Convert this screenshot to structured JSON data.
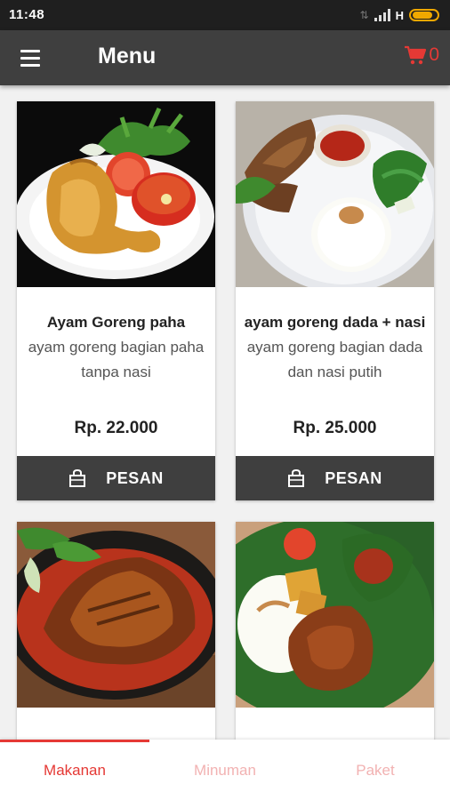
{
  "status_bar": {
    "time": "11:48",
    "network": "H"
  },
  "app_bar": {
    "title": "Menu",
    "cart_count": "0"
  },
  "menu_items": [
    {
      "name": "Ayam Goreng paha",
      "description": "ayam goreng bagian paha tanpa nasi",
      "price": "Rp. 22.000",
      "button": "PESAN"
    },
    {
      "name": "ayam goreng dada + nasi",
      "description": "ayam goreng bagian dada dan nasi putih",
      "price": "Rp. 25.000",
      "button": "PESAN"
    }
  ],
  "bottom_nav": [
    {
      "label": "Makanan"
    },
    {
      "label": "Minuman"
    },
    {
      "label": "Paket"
    }
  ],
  "colors": {
    "accent": "#e53935",
    "appbar": "#3f3f3f",
    "statusbar": "#1f1f1f"
  }
}
